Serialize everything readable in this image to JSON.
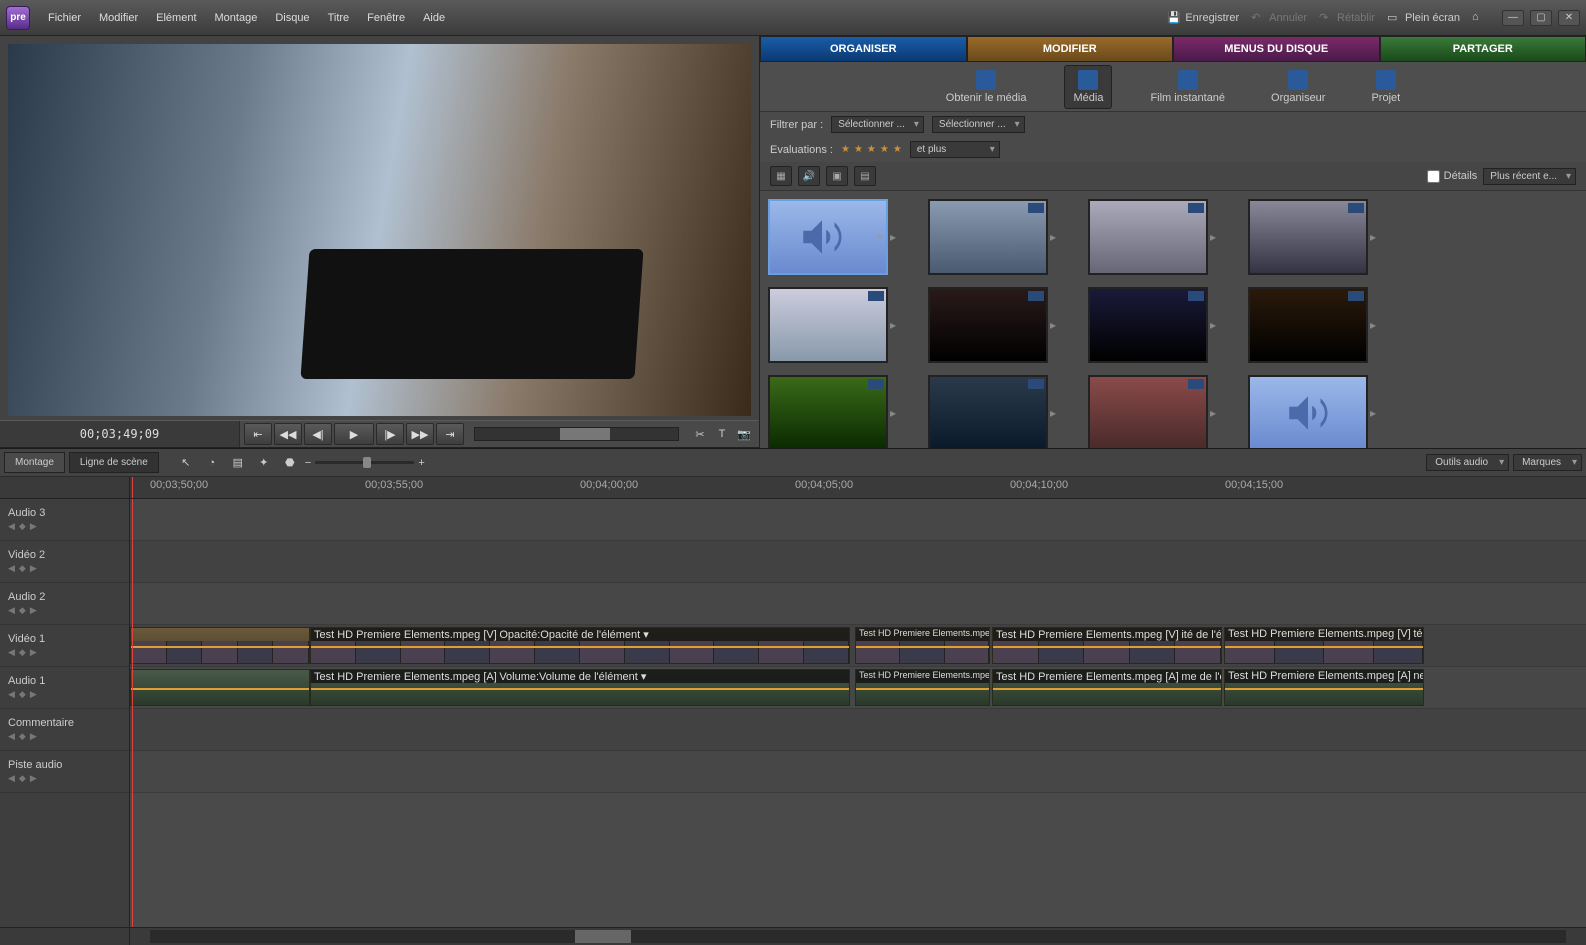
{
  "menubar": [
    "Fichier",
    "Modifier",
    "Elément",
    "Montage",
    "Disque",
    "Titre",
    "Fenêtre",
    "Aide"
  ],
  "titlebar": {
    "save": "Enregistrer",
    "undo": "Annuler",
    "redo": "Rétablir",
    "fullscreen": "Plein écran"
  },
  "monitor": {
    "timecode": "00;03;49;09"
  },
  "tabs": {
    "organize": "ORGANISER",
    "modify": "MODIFIER",
    "disc": "MENUS DU DISQUE",
    "share": "PARTAGER"
  },
  "subtools": {
    "getmedia": "Obtenir le média",
    "media": "Média",
    "instant": "Film instantané",
    "organizer": "Organiseur",
    "project": "Projet"
  },
  "filters": {
    "filterby": "Filtrer par :",
    "select": "Sélectionner ...",
    "ratings": "Evaluations :",
    "andup": "et plus",
    "details": "Détails",
    "sort": "Plus récent e..."
  },
  "timeline": {
    "tab_montage": "Montage",
    "tab_scene": "Ligne de scène",
    "audio_tools": "Outils audio",
    "markers": "Marques",
    "ruler": [
      "00;03;50;00",
      "00;03;55;00",
      "00;04;00;00",
      "00;04;05;00",
      "00;04;10;00",
      "00;04;15;00"
    ],
    "tracks": [
      "Audio 3",
      "Vidéo 2",
      "Audio 2",
      "Vidéo 1",
      "Audio 1",
      "Commentaire",
      "Piste audio"
    ],
    "clip_v_name": "Test HD Premiere Elements.mpeg [V]",
    "clip_a_name": "Test HD Premiere Elements.mpeg [A]",
    "opacity_label": "Opacité:Opacité de l'élément ▾",
    "volume_label": "Volume:Volume de l'élément ▾",
    "clip_v_short1": "Test HD Premiere Elements.mpe",
    "clip_v_short2": "Test HD Premiere Elements.mpeg [V]",
    "clip_v_short3": "ité de l'élément ▾",
    "clip_v_short4": "Test HD Premiere Elements.mpeg [V]",
    "clip_v_short5": "té:O",
    "clip_a_short1": "Test HD Premiere Elements.mpe",
    "clip_a_short2": "Test HD Premiere Elements.mpeg [A]",
    "clip_a_short3": "me de l'élément ▾",
    "clip_a_short4": "Test HD Premiere Elements.mpeg [A]",
    "clip_a_short5": "ne:V"
  }
}
